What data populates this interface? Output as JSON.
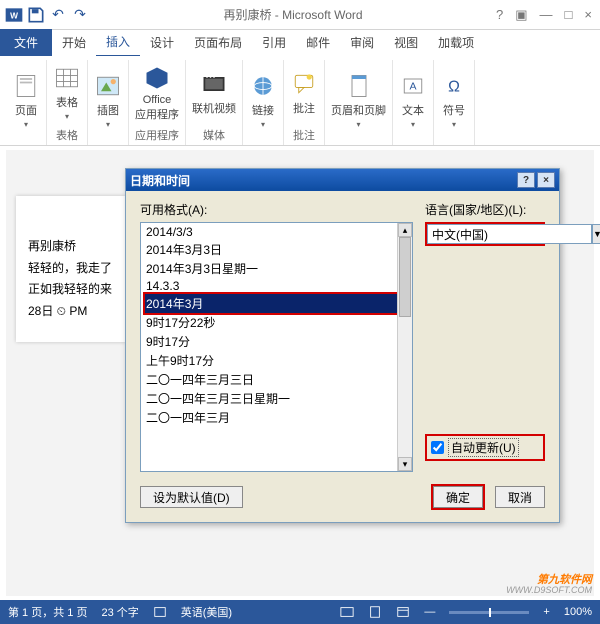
{
  "titlebar": {
    "title": "再别康桥 - Microsoft Word"
  },
  "menu": {
    "file": "文件",
    "items": [
      "开始",
      "插入",
      "设计",
      "页面布局",
      "引用",
      "邮件",
      "审阅",
      "视图",
      "加载项"
    ],
    "active_index": 1
  },
  "ribbon": {
    "groups": [
      {
        "buttons": [
          {
            "label": "页面"
          }
        ],
        "label": ""
      },
      {
        "buttons": [
          {
            "label": "表格"
          }
        ],
        "label": "表格"
      },
      {
        "buttons": [
          {
            "label": "插图"
          }
        ],
        "label": ""
      },
      {
        "buttons": [
          {
            "label": "Office\n应用程序"
          }
        ],
        "label": "应用程序"
      },
      {
        "buttons": [
          {
            "label": "联机视频"
          }
        ],
        "label": "媒体"
      },
      {
        "buttons": [
          {
            "label": "链接"
          }
        ],
        "label": ""
      },
      {
        "buttons": [
          {
            "label": "批注"
          }
        ],
        "label": "批注"
      },
      {
        "buttons": [
          {
            "label": "页眉和页脚"
          }
        ],
        "label": ""
      },
      {
        "buttons": [
          {
            "label": "文本"
          }
        ],
        "label": ""
      },
      {
        "buttons": [
          {
            "label": "符号"
          }
        ],
        "label": ""
      }
    ]
  },
  "doc": {
    "lines": [
      "再别康桥",
      "轻轻的，我走了",
      "正如我轻轻的来",
      "28日  ⏲  PM"
    ]
  },
  "dialog": {
    "title": "日期和时间",
    "formats_label": "可用格式(A):",
    "language_label": "语言(国家/地区)(L):",
    "formats": [
      "2014/3/3",
      "2014年3月3日",
      "2014年3月3日星期一",
      "14.3.3",
      "2014年3月",
      "9时17分22秒",
      "9时17分",
      "上午9时17分",
      "二〇一四年三月三日",
      "二〇一四年三月三日星期一",
      "二〇一四年三月"
    ],
    "selected_format_index": 4,
    "language": "中文(中国)",
    "auto_update_label": "自动更新(U)",
    "auto_update_checked": true,
    "default_btn": "设为默认值(D)",
    "ok_btn": "确定",
    "cancel_btn": "取消"
  },
  "status": {
    "page": "第 1 页，共 1 页",
    "words": "23 个字",
    "lang": "英语(美国)",
    "zoom": "100%"
  },
  "watermark": {
    "line1": "第九软件网",
    "line2": "WWW.D9SOFT.COM"
  }
}
